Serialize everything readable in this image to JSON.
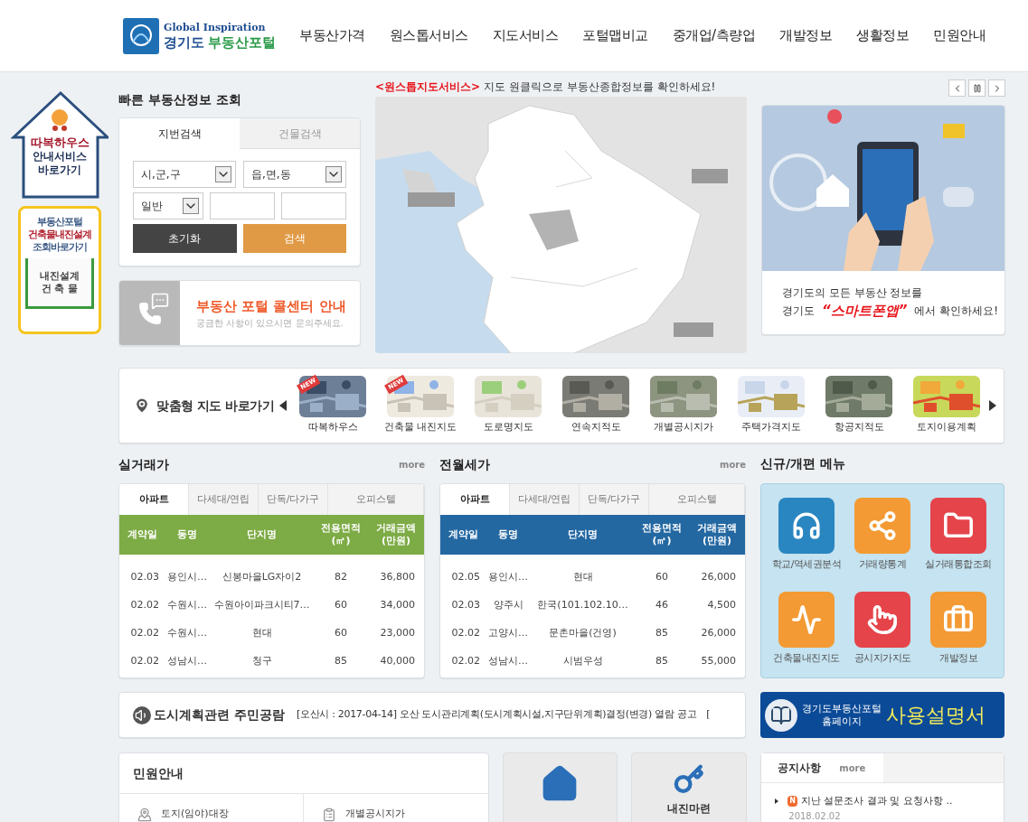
{
  "header": {
    "tagline": "Global Inspiration",
    "region": "경기도",
    "name": "부동산포털",
    "nav": [
      "부동산가격",
      "원스톱서비스",
      "지도서비스",
      "포털맵비교",
      "중개업/측량업",
      "개발정보",
      "생활정보",
      "민원안내"
    ]
  },
  "side_banners": {
    "house": {
      "title": "따복하우스",
      "lines": [
        "안내서비스",
        "바로가기"
      ]
    },
    "quake": {
      "lines": [
        "부동산포털",
        "건축물내진설계",
        "조회바로가기"
      ],
      "sign": [
        "내진설계",
        "건 축 물"
      ]
    }
  },
  "quick_search": {
    "title": "빠른 부동산정보 조회",
    "tabs": [
      {
        "label": "지번검색",
        "selected": true
      },
      {
        "label": "건물검색",
        "selected": false
      }
    ],
    "selects": [
      "시,군,구",
      "읍,면,동",
      "일반"
    ],
    "reset": "초기화",
    "search": "검색"
  },
  "call_center": {
    "title": "부동산 포털 콜센터 안내",
    "subtitle": "궁금한 사항이 있으시면 문의주세요."
  },
  "map_service": {
    "tag": "<원스톱지도서비스>",
    "text": "지도 원클릭으로 부동산종합정보를 확인하세요!"
  },
  "app_promo": {
    "line1": "경기도의 모든 부동산 정보를",
    "prefix": "경기도",
    "highlight": "“스마트폰앱”",
    "suffix": "에서 확인하세요!"
  },
  "map_shortcuts": {
    "title": "맞춤형 지도 바로가기",
    "items": [
      {
        "label": "따복하우스",
        "badge": "NEW"
      },
      {
        "label": "건축물 내진지도",
        "badge": "NEW"
      },
      {
        "label": "도로명지도"
      },
      {
        "label": "연속지적도"
      },
      {
        "label": "개별공시지가"
      },
      {
        "label": "주택가격지도"
      },
      {
        "label": "항공지적도"
      },
      {
        "label": "토지이용계획"
      }
    ]
  },
  "price_tables": [
    {
      "title": "실거래가",
      "more": "more",
      "color": "#7dab45",
      "tabs": [
        {
          "label": "아파트",
          "selected": true
        },
        {
          "label": "다세대/연립",
          "selected": false
        },
        {
          "label": "단독/다가구",
          "selected": false
        },
        {
          "label": "오피스텔",
          "selected": false
        }
      ],
      "columns": [
        "계약일",
        "동명",
        "단지명",
        "전용면적\n(㎡)",
        "거래금액\n(만원)"
      ],
      "rows": [
        [
          "02.03",
          "용인시…",
          "신봉마을LG자이2",
          "82",
          "36,800"
        ],
        [
          "02.02",
          "수원시…",
          "수원아이파크시티7…",
          "60",
          "34,000"
        ],
        [
          "02.02",
          "수원시…",
          "현대",
          "60",
          "23,000"
        ],
        [
          "02.02",
          "성남시…",
          "청구",
          "85",
          "40,000"
        ]
      ]
    },
    {
      "title": "전월세가",
      "more": "more",
      "color": "#2468a2",
      "tabs": [
        {
          "label": "아파트",
          "selected": true
        },
        {
          "label": "다세대/연립",
          "selected": false
        },
        {
          "label": "단독/다가구",
          "selected": false
        },
        {
          "label": "오피스텔",
          "selected": false
        }
      ],
      "columns": [
        "계약일",
        "동명",
        "단지명",
        "전용면적\n(㎡)",
        "거래금액\n(만원)"
      ],
      "rows": [
        [
          "02.05",
          "용인시…",
          "현대",
          "60",
          "26,000"
        ],
        [
          "02.03",
          "양주시",
          "한국(101.102.10…",
          "46",
          "4,500"
        ],
        [
          "02.02",
          "고양시…",
          "문촌마을(건영)",
          "85",
          "26,000"
        ],
        [
          "02.02",
          "성남시…",
          "시범우성",
          "85",
          "55,000"
        ]
      ]
    }
  ],
  "new_menu": {
    "title": "신규/개편 메뉴",
    "items": [
      {
        "label": "학교/역세권분석",
        "kind": "headphones",
        "color": "#2a86c0"
      },
      {
        "label": "거래량통계",
        "kind": "graph",
        "color": "#f39a34"
      },
      {
        "label": "실거래통합조회",
        "kind": "folder",
        "color": "#e5444a"
      },
      {
        "label": "건축물내진지도",
        "kind": "pulse",
        "color": "#f39a34"
      },
      {
        "label": "공시지가지도",
        "kind": "hand",
        "color": "#e5444a"
      },
      {
        "label": "개발정보",
        "kind": "briefcase",
        "color": "#f39a34"
      }
    ]
  },
  "ticker": {
    "title": "도시계획관련 주민공람",
    "text": "[오산시 : 2017-04-14] 오산 도시관리계획(도시계획시설,지구단위계획)결정(변경) 열람 공고",
    "next": "["
  },
  "manual_banner": {
    "line1": "경기도부동산포털",
    "line2": "홈페이지",
    "big": "사용설명서"
  },
  "civil": {
    "title": "민원안내",
    "items": [
      {
        "label": "토지(임야)대장",
        "kind": "pin"
      },
      {
        "label": "개별공시지가",
        "kind": "clipboard"
      }
    ]
  },
  "tiles": [
    {
      "kind": "house"
    },
    {
      "kind": "key",
      "label": "내진마련"
    }
  ],
  "notices": {
    "tab": {
      "label": "공지사항",
      "selected": true
    },
    "more": "more",
    "items": [
      {
        "badge": "N",
        "title": "지난 설문조사 결과 및 요청사항 ..",
        "date": "2018.02.02"
      }
    ]
  }
}
